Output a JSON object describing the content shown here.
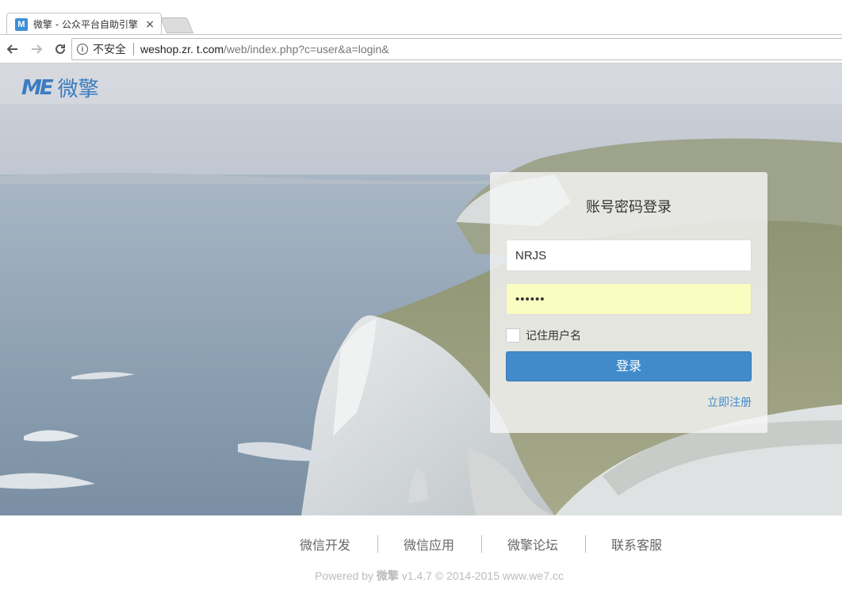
{
  "browser": {
    "tab_title": "微擎 - 公众平台自助引擎",
    "favicon_letter": "M",
    "close_glyph": "×",
    "security_label": "不安全",
    "url_host": "weshop.zr.    t.com",
    "url_path": "/web/index.php?c=user&a=login&"
  },
  "brand": {
    "logo_mark": "ME",
    "logo_text": "微擎",
    "color": "#3b7cc1"
  },
  "login": {
    "title": "账号密码登录",
    "username_value": "NRJS",
    "password_value": "••••••",
    "remember_label": "记住用户名",
    "submit_label": "登录",
    "register_link": "立即注册",
    "button_color": "#428bca"
  },
  "footer": {
    "links": [
      "微信开发",
      "微信应用",
      "微擎论坛",
      "联系客服"
    ],
    "powered_prefix": "Powered by ",
    "powered_brand": "微擎",
    "powered_suffix": " v1.4.7 © 2014-2015 www.we7.cc"
  }
}
